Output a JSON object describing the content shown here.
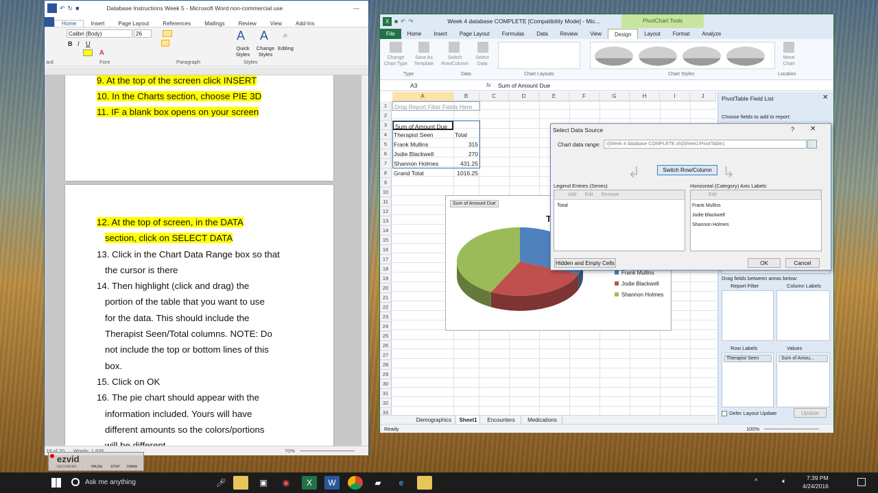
{
  "word": {
    "title": "Database Instructions  Week 5 - Microsoft Word non-commercial use",
    "tabs": [
      "Home",
      "Insert",
      "Page Layout",
      "References",
      "Mailings",
      "Review",
      "View",
      "Add-Ins"
    ],
    "font_name": "Calibri (Body)",
    "font_size": "26",
    "groups": {
      "font": "Font",
      "paragraph": "Paragraph",
      "styles": "Styles",
      "clipboard": "ard"
    },
    "quick_styles": "Quick Styles",
    "change_styles": "Change Styles",
    "editing": "Editing",
    "page1_lines": [
      "9.  At the top of the screen click INSERT",
      "10. In the Charts section, choose PIE 3D",
      "11. IF a blank box opens on your screen"
    ],
    "page2_lines": [
      {
        "text": "12. At the top of screen, in the DATA",
        "hl": true
      },
      {
        "text": "section, click on SELECT DATA",
        "hl": true
      },
      {
        "text": "13. Click in the Chart Data Range box so that",
        "hl": false
      },
      {
        "text": "the cursor is there",
        "hl": false
      },
      {
        "text": "14. Then highlight (click and drag) the",
        "hl": false
      },
      {
        "text": "portion of the table that you want to use",
        "hl": false
      },
      {
        "text": "for the data.  This should include the",
        "hl": false
      },
      {
        "text": "Therapist Seen/Total columns.  NOTE:  Do",
        "hl": false
      },
      {
        "text": "not include the top or bottom lines of this",
        "hl": false
      },
      {
        "text": "box.",
        "hl": false
      },
      {
        "text": "15. Click on OK",
        "hl": false
      },
      {
        "text": "16. The pie chart should appear with the",
        "hl": false
      },
      {
        "text": "information included.  Yours will have",
        "hl": false
      },
      {
        "text": "different amounts so the colors/portions",
        "hl": false
      },
      {
        "text": "will be different",
        "hl": false
      }
    ],
    "status_page": "19 of 20",
    "status_words": "Words: 1,835",
    "zoom": "70%"
  },
  "excel": {
    "title": "Week 4 database COMPLETE  [Compatibility Mode] - Mic...",
    "pivot_tools": "PivotChart Tools",
    "tabs": [
      "File",
      "Home",
      "Insert",
      "Page Layout",
      "Formulas",
      "Data",
      "Review",
      "View",
      "Design",
      "Layout",
      "Format",
      "Analyze"
    ],
    "ribbon": {
      "change_chart_type": "Change Chart Type",
      "save_as_template": "Save As Template",
      "switch_row_column": "Switch Row/Column",
      "select_data": "Select Data",
      "group_type": "Type",
      "group_data": "Data",
      "group_layouts": "Chart Layouts",
      "group_styles": "Chart Styles",
      "move_chart": "Move Chart",
      "group_location": "Location"
    },
    "name_box": "A3",
    "formula": "Sum of Amount Due",
    "columns": [
      "A",
      "B",
      "C",
      "D",
      "E",
      "F",
      "G",
      "H",
      "I",
      "J"
    ],
    "rows": [
      "1",
      "2",
      "3",
      "4",
      "5",
      "6",
      "7",
      "8",
      "9",
      "10",
      "11",
      "12",
      "13",
      "14",
      "15",
      "16",
      "17",
      "18",
      "19",
      "20",
      "21",
      "22",
      "23",
      "24",
      "25",
      "26",
      "27",
      "28",
      "29",
      "30",
      "31",
      "32",
      "33"
    ],
    "drop_filter": "Drop Report Filter Fields Here",
    "pivot": {
      "header_a": "Sum of Amount Due",
      "row_label": "Therapist Seen",
      "total_label": "Total",
      "entries": [
        {
          "name": "Frank Mullins",
          "value": "315"
        },
        {
          "name": "Jodie Blackwell",
          "value": "270"
        },
        {
          "name": "Shannon Holmes",
          "value": "431.25"
        }
      ],
      "grand_total_label": "Grand Total",
      "grand_total": "1016.25"
    },
    "chart": {
      "field_button": "Sum of Amount Due",
      "title_fragment": "T",
      "legend": [
        {
          "name": "Frank Mullins",
          "color": "#4f81bd"
        },
        {
          "name": "Jodie Blackwell",
          "color": "#c0504d"
        },
        {
          "name": "Shannon Holmes",
          "color": "#9bbb59"
        }
      ]
    },
    "sheet_tabs": [
      "Demographics",
      "Sheet1",
      "Encounters",
      "Medications"
    ],
    "status": "Ready",
    "zoom": "100%",
    "field_list": {
      "title": "PivotTable Field List",
      "choose": "Choose fields to add to report:",
      "drag": "Drag fields between areas below:",
      "report_filter": "Report Filter",
      "column_labels": "Column Labels",
      "row_labels": "Row Labels",
      "values": "Values",
      "row_field": "Therapist Seen",
      "value_field": "Sum of Amou...",
      "defer": "Defer Layout Update",
      "update": "Update"
    }
  },
  "dialog": {
    "title": "Select Data Source",
    "help": "?",
    "range_label": "Chart data range:",
    "range_value": "=[Week 4 database COMPLETE.xls]Sheet1!PivotTable1",
    "switch": "Switch Row/Column",
    "legend_title": "Legend Entries (Series)",
    "add": "Add",
    "edit": "Edit",
    "remove": "Remove",
    "series": [
      "Total"
    ],
    "axis_title": "Horizontal (Category) Axis Labels",
    "axis_edit": "Edit",
    "axis_labels": [
      "Frank Mullins",
      "Jodie Blackwell",
      "Shannon Holmes"
    ],
    "hidden_cells": "Hidden and Empty Cells",
    "ok": "OK",
    "cancel": "Cancel"
  },
  "taskbar": {
    "search": "Ask me anything",
    "time": "7:39 PM",
    "date": "4/24/2016"
  },
  "ezvid": {
    "brand": "ezvid",
    "sub": "RECORDER",
    "pause": "PAUSE",
    "stop": "STOP",
    "draw": "DRAW"
  }
}
